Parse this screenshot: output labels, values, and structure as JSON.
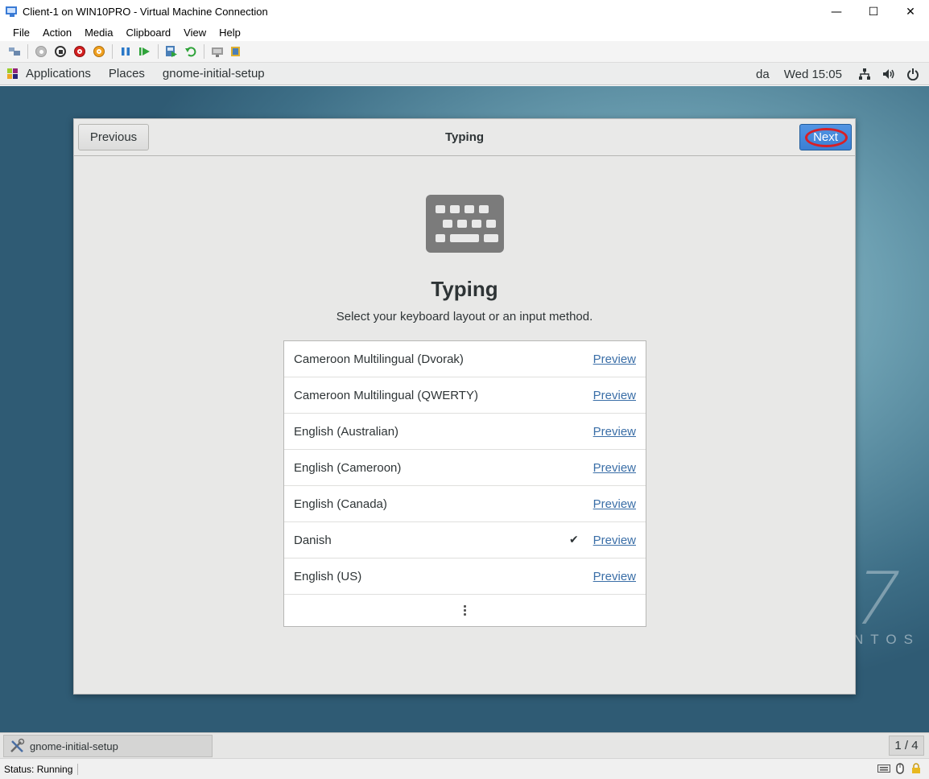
{
  "window": {
    "title": "Client-1 on WIN10PRO - Virtual Machine Connection",
    "minimize": "—",
    "maximize": "☐",
    "close": "✕"
  },
  "menubar": {
    "items": [
      "File",
      "Action",
      "Media",
      "Clipboard",
      "View",
      "Help"
    ]
  },
  "gnome_topbar": {
    "applications": "Applications",
    "places": "Places",
    "app_name": "gnome-initial-setup",
    "keyboard_indicator": "da",
    "clock": "Wed 15:05"
  },
  "desktop": {
    "watermark_number": "7",
    "watermark_text": "NTOS"
  },
  "dialog": {
    "previous_label": "Previous",
    "title": "Typing",
    "next_label": "Next",
    "heading": "Typing",
    "subheading": "Select your keyboard layout or an input method.",
    "layouts": [
      {
        "name": "Cameroon Multilingual (Dvorak)",
        "preview": "Preview",
        "check": ""
      },
      {
        "name": "Cameroon Multilingual (QWERTY)",
        "preview": "Preview",
        "check": ""
      },
      {
        "name": "English (Australian)",
        "preview": "Preview",
        "check": ""
      },
      {
        "name": "English (Cameroon)",
        "preview": "Preview",
        "check": ""
      },
      {
        "name": "English (Canada)",
        "preview": "Preview",
        "check": ""
      },
      {
        "name": "Danish",
        "preview": "Preview",
        "check": "✔"
      },
      {
        "name": "English (US)",
        "preview": "Preview",
        "check": ""
      }
    ]
  },
  "taskbar": {
    "task_label": "gnome-initial-setup",
    "workspace": "1 / 4"
  },
  "statusbar": {
    "status": "Status: Running"
  },
  "colors": {
    "accent_blue": "#3b7fd4",
    "annotation_red": "#d81f26",
    "link_blue": "#3a6ea7"
  }
}
